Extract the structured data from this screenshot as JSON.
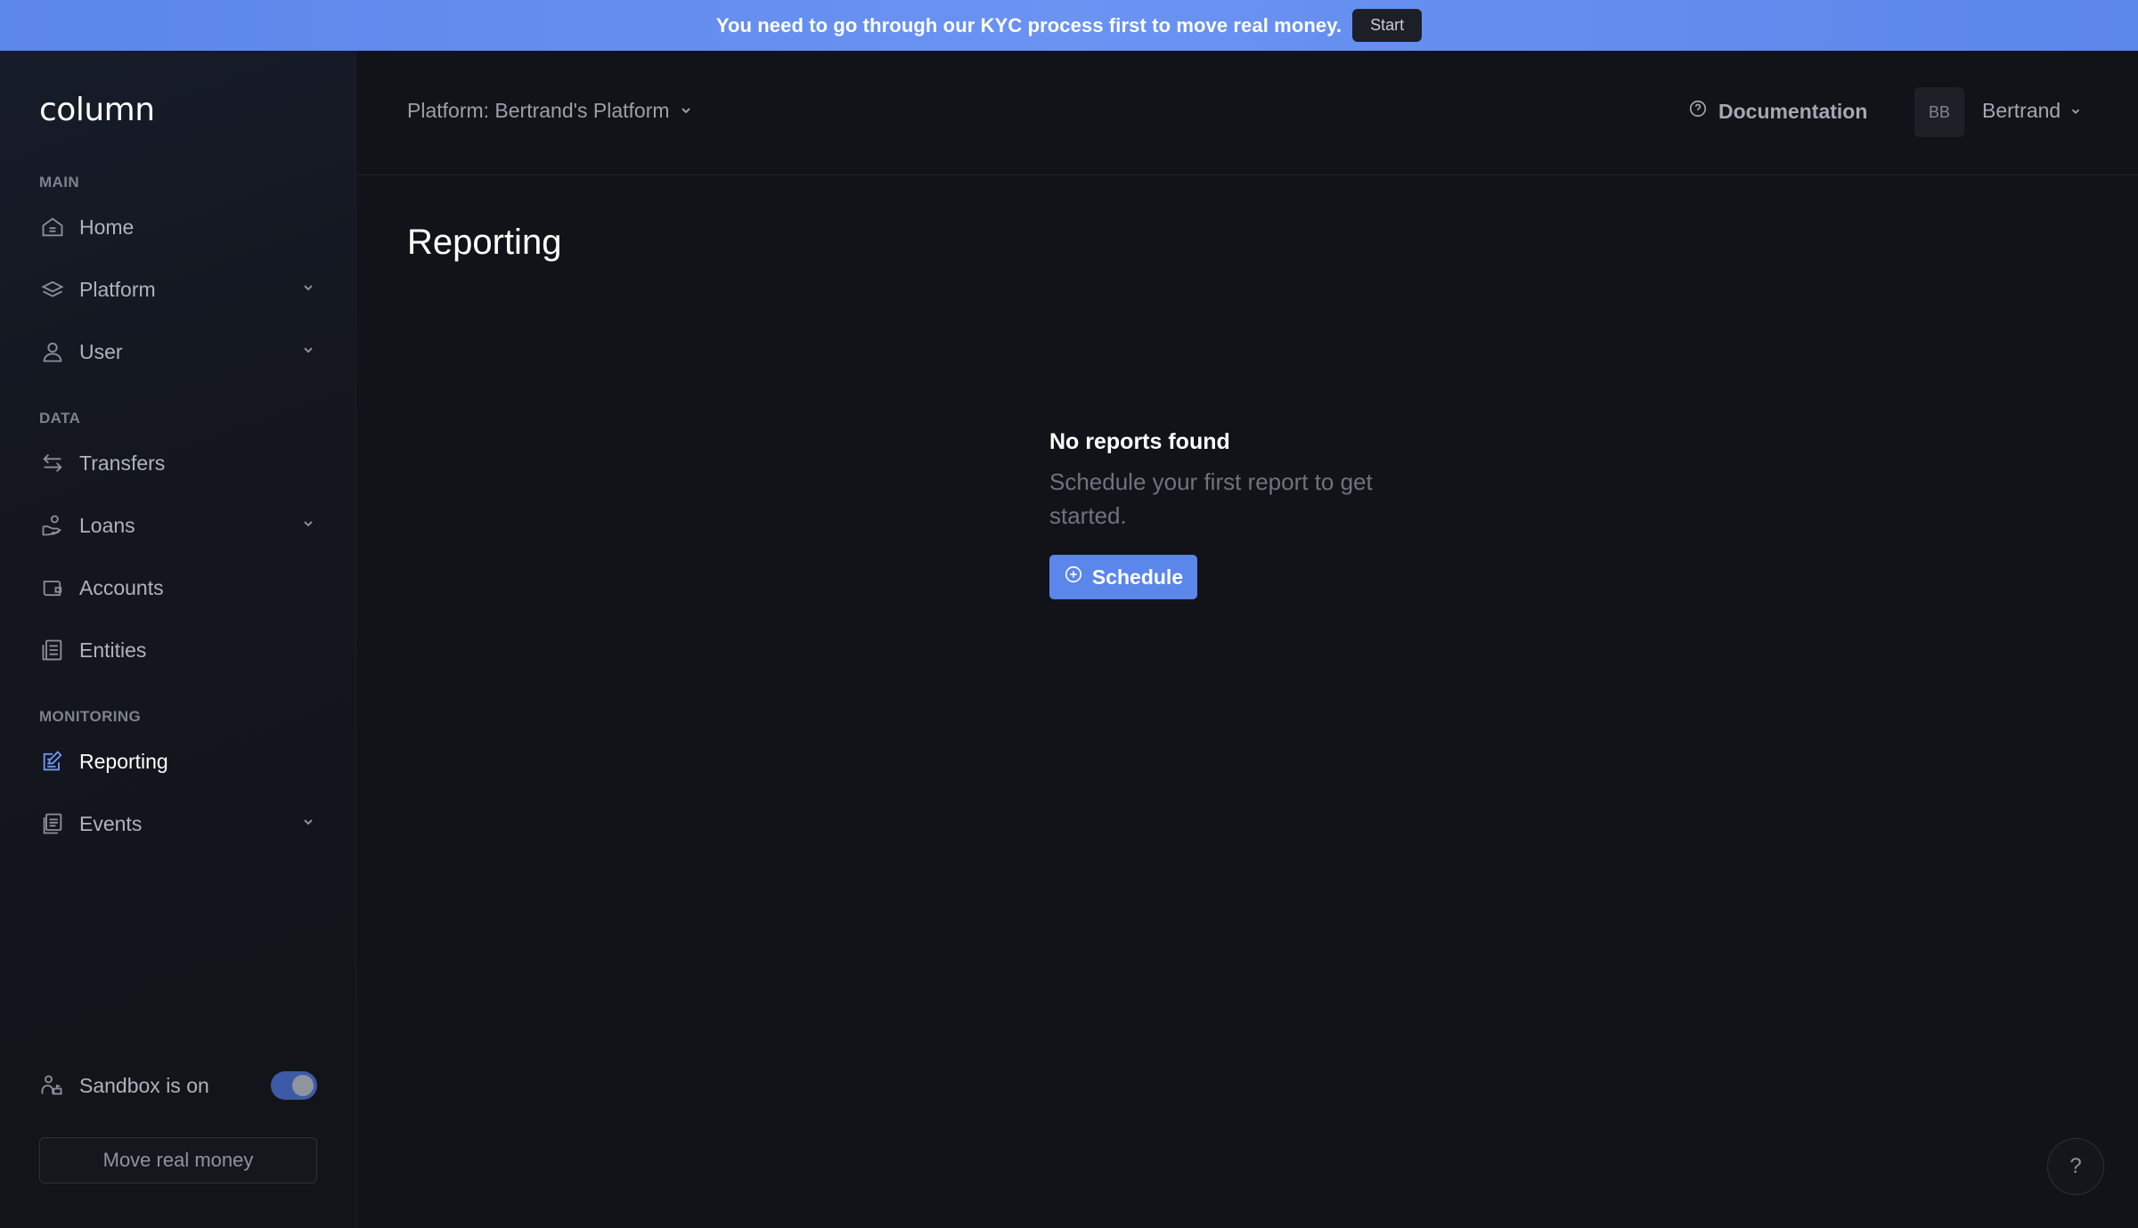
{
  "banner": {
    "text": "You need to go through our KYC process first to move real money.",
    "button_label": "Start"
  },
  "sidebar": {
    "logo": "column",
    "sections": {
      "main": "MAIN",
      "data": "DATA",
      "monitoring": "MONITORING"
    },
    "items": [
      {
        "label": "Home",
        "icon": "home-icon",
        "has_chevron": false
      },
      {
        "label": "Platform",
        "icon": "layers-icon",
        "has_chevron": true
      },
      {
        "label": "User",
        "icon": "user-icon",
        "has_chevron": true
      },
      {
        "label": "Transfers",
        "icon": "transfer-arrows-icon",
        "has_chevron": false
      },
      {
        "label": "Loans",
        "icon": "hand-coin-icon",
        "has_chevron": true
      },
      {
        "label": "Accounts",
        "icon": "wallet-icon",
        "has_chevron": false
      },
      {
        "label": "Entities",
        "icon": "document-list-icon",
        "has_chevron": false
      },
      {
        "label": "Reporting",
        "icon": "report-edit-icon",
        "has_chevron": false,
        "active": true
      },
      {
        "label": "Events",
        "icon": "events-icon",
        "has_chevron": true
      }
    ],
    "sandbox_label": "Sandbox is on",
    "sandbox_on": true,
    "move_money_label": "Move real money"
  },
  "header": {
    "platform_selector": "Platform: Bertrand's Platform",
    "documentation_label": "Documentation",
    "avatar_initials": "BB",
    "user_name": "Bertrand"
  },
  "main": {
    "page_title": "Reporting",
    "empty_title": "No reports found",
    "empty_description": "Schedule your first report to get started.",
    "schedule_label": "Schedule"
  },
  "help_label": "?",
  "colors": {
    "accent": "#5b86ea",
    "background": "#111318",
    "sidebar": "#13161d"
  }
}
